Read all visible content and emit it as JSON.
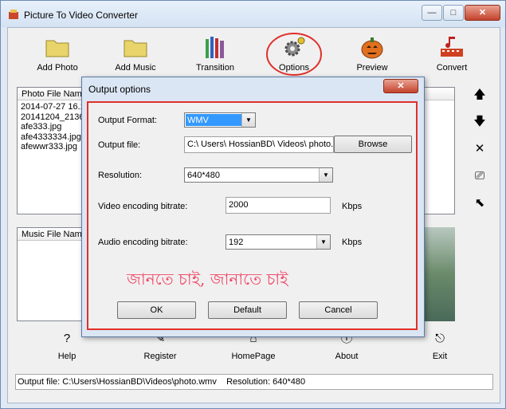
{
  "window": {
    "title": "Picture To Video Converter",
    "min": "—",
    "max": "□",
    "close": "✕"
  },
  "toolbar": [
    {
      "label": "Add Photo",
      "icon": "folder-icon"
    },
    {
      "label": "Add Music",
      "icon": "folder-icon"
    },
    {
      "label": "Transition",
      "icon": "pencils-icon"
    },
    {
      "label": "Options",
      "icon": "gear-icon"
    },
    {
      "label": "Preview",
      "icon": "pumpkin-icon"
    },
    {
      "label": "Convert",
      "icon": "film-music-icon"
    }
  ],
  "photo_list": {
    "header": "Photo File Name",
    "items": [
      "2014-07-27 16.1",
      "20141204_2136",
      "afe333.jpg",
      "afe4333334.jpg",
      "afewwr333.jpg"
    ]
  },
  "music_list": {
    "header": "Music File Name"
  },
  "side_buttons": [
    {
      "icon": "arrow-up-icon",
      "glyph": "🡅"
    },
    {
      "icon": "arrow-down-icon",
      "glyph": "🡇"
    },
    {
      "icon": "delete-icon",
      "glyph": "✕"
    },
    {
      "icon": "clear-icon",
      "glyph": "⎚"
    },
    {
      "icon": "arrow-top-left-icon",
      "glyph": "⬉"
    }
  ],
  "bottom": [
    {
      "label": "Help",
      "icon": "help-icon",
      "glyph": "?"
    },
    {
      "label": "Register",
      "icon": "register-icon",
      "glyph": "✎"
    },
    {
      "label": "HomePage",
      "icon": "home-icon",
      "glyph": "⌂"
    },
    {
      "label": "About",
      "icon": "about-icon",
      "glyph": "ⓘ"
    },
    {
      "label": "Exit",
      "icon": "exit-icon",
      "glyph": "⎋"
    }
  ],
  "status": "Output file: C:\\Users\\HossianBD\\Videos\\photo.wmv    Resolution: 640*480",
  "dialog": {
    "title": "Output options",
    "close": "✕",
    "format_label": "Output Format:",
    "format_value": "WMV",
    "file_label": "Output file:",
    "file_value": "C:\\ Users\\ HossianBD\\ Videos\\ photo.wmv",
    "browse": "Browse",
    "resolution_label": "Resolution:",
    "resolution_value": "640*480",
    "vbitrate_label": "Video encoding bitrate:",
    "vbitrate_value": "2000",
    "abitrate_label": "Audio encoding bitrate:",
    "abitrate_value": "192",
    "unit": "Kbps",
    "watermark": "জানতে চাই, জানাতে চাই",
    "ok": "OK",
    "default": "Default",
    "cancel": "Cancel",
    "arrow": "▼"
  },
  "colors": {
    "highlight": "#e0302a",
    "selection": "#3399ff",
    "watermark": "#f04a6a"
  }
}
